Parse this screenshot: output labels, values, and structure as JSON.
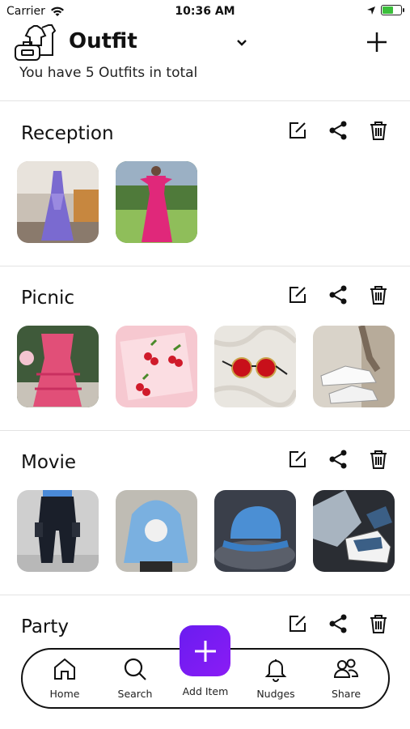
{
  "status_bar": {
    "carrier": "Carrier",
    "time": "10:36 AM",
    "battery_level": 0.6
  },
  "header": {
    "title": "Outfit",
    "subtitle": "You have 5 Outfits in total"
  },
  "outfits": [
    {
      "name": "Reception",
      "items": [
        "purple-gown",
        "pink-gown"
      ]
    },
    {
      "name": "Picnic",
      "items": [
        "pink-dress",
        "cherry-earrings",
        "red-sunglasses",
        "white-sneakers"
      ]
    },
    {
      "name": "Movie",
      "items": [
        "black-cargo-pants",
        "blue-hoodie",
        "blue-cap",
        "blue-sneakers"
      ]
    },
    {
      "name": "Party",
      "items": []
    }
  ],
  "nav": {
    "home": "Home",
    "search": "Search",
    "add_item": "Add Item",
    "nudges": "Nudges",
    "share": "Share"
  },
  "colors": {
    "fab": "#7a1cf2",
    "divider": "#e3e3e3"
  }
}
